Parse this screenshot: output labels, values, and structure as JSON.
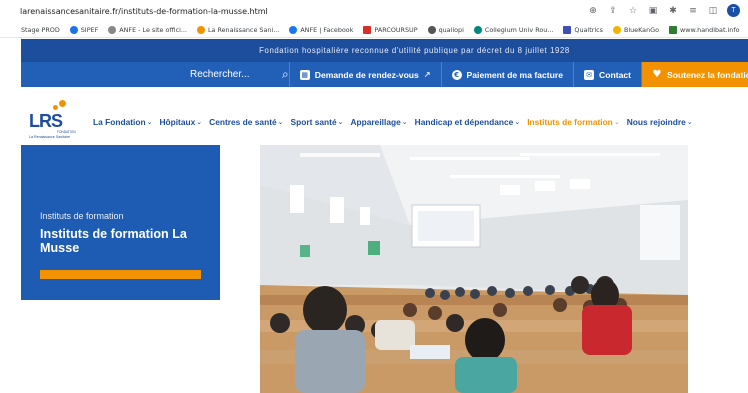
{
  "browser": {
    "url": "larenaissancesanitaire.fr/instituts-de-formation-la-musse.html",
    "profile_initial": "T",
    "bookmarks": [
      {
        "label": "Stage PROD",
        "color": ""
      },
      {
        "label": "SIPEF",
        "color": "#1a73e8"
      },
      {
        "label": "ANFE - Le site offici...",
        "color": "#888888"
      },
      {
        "label": "La Renaissance Sani...",
        "color": "#f39200"
      },
      {
        "label": "ANFE | Facebook",
        "color": "#1877f2"
      },
      {
        "label": "PARCOURSUP",
        "color": "#d93025"
      },
      {
        "label": "qualiopi",
        "color": "#555555"
      },
      {
        "label": "Collegium Univ Rou...",
        "color": "#00897b"
      },
      {
        "label": "Qualtrics",
        "color": "#3f51b5"
      },
      {
        "label": "BlueKanGo",
        "color": "#f2b400"
      },
      {
        "label": "www.handibat.info",
        "color": "#2e7d32"
      }
    ]
  },
  "topbar": {
    "text": "Fondation hospitalière reconnue d'utilité publique par décret du 8 juillet 1928"
  },
  "navbar": {
    "search_label": "Rechercher...",
    "items": [
      {
        "label": "Demande de rendez-vous"
      },
      {
        "label": "Paiement de ma facture"
      },
      {
        "label": "Contact"
      },
      {
        "label": "Soutenez la fondation"
      }
    ]
  },
  "logo": {
    "text": "LRS",
    "subtitle": "La Renaissance Sanitaire",
    "fondation": "FONDATION"
  },
  "menu": {
    "items": [
      {
        "label": "La Fondation"
      },
      {
        "label": "Hôpitaux"
      },
      {
        "label": "Centres de santé"
      },
      {
        "label": "Sport santé"
      },
      {
        "label": "Appareillage"
      },
      {
        "label": "Handicap et dépendance"
      },
      {
        "label": "Instituts de formation"
      },
      {
        "label": "Nous rejoindre"
      }
    ]
  },
  "hero": {
    "kicker": "Instituts de formation",
    "title": "Instituts de formation La Musse"
  },
  "colors": {
    "brand_blue": "#1d4e9e",
    "nav_blue": "#2260b8",
    "accent_orange": "#f39200"
  }
}
